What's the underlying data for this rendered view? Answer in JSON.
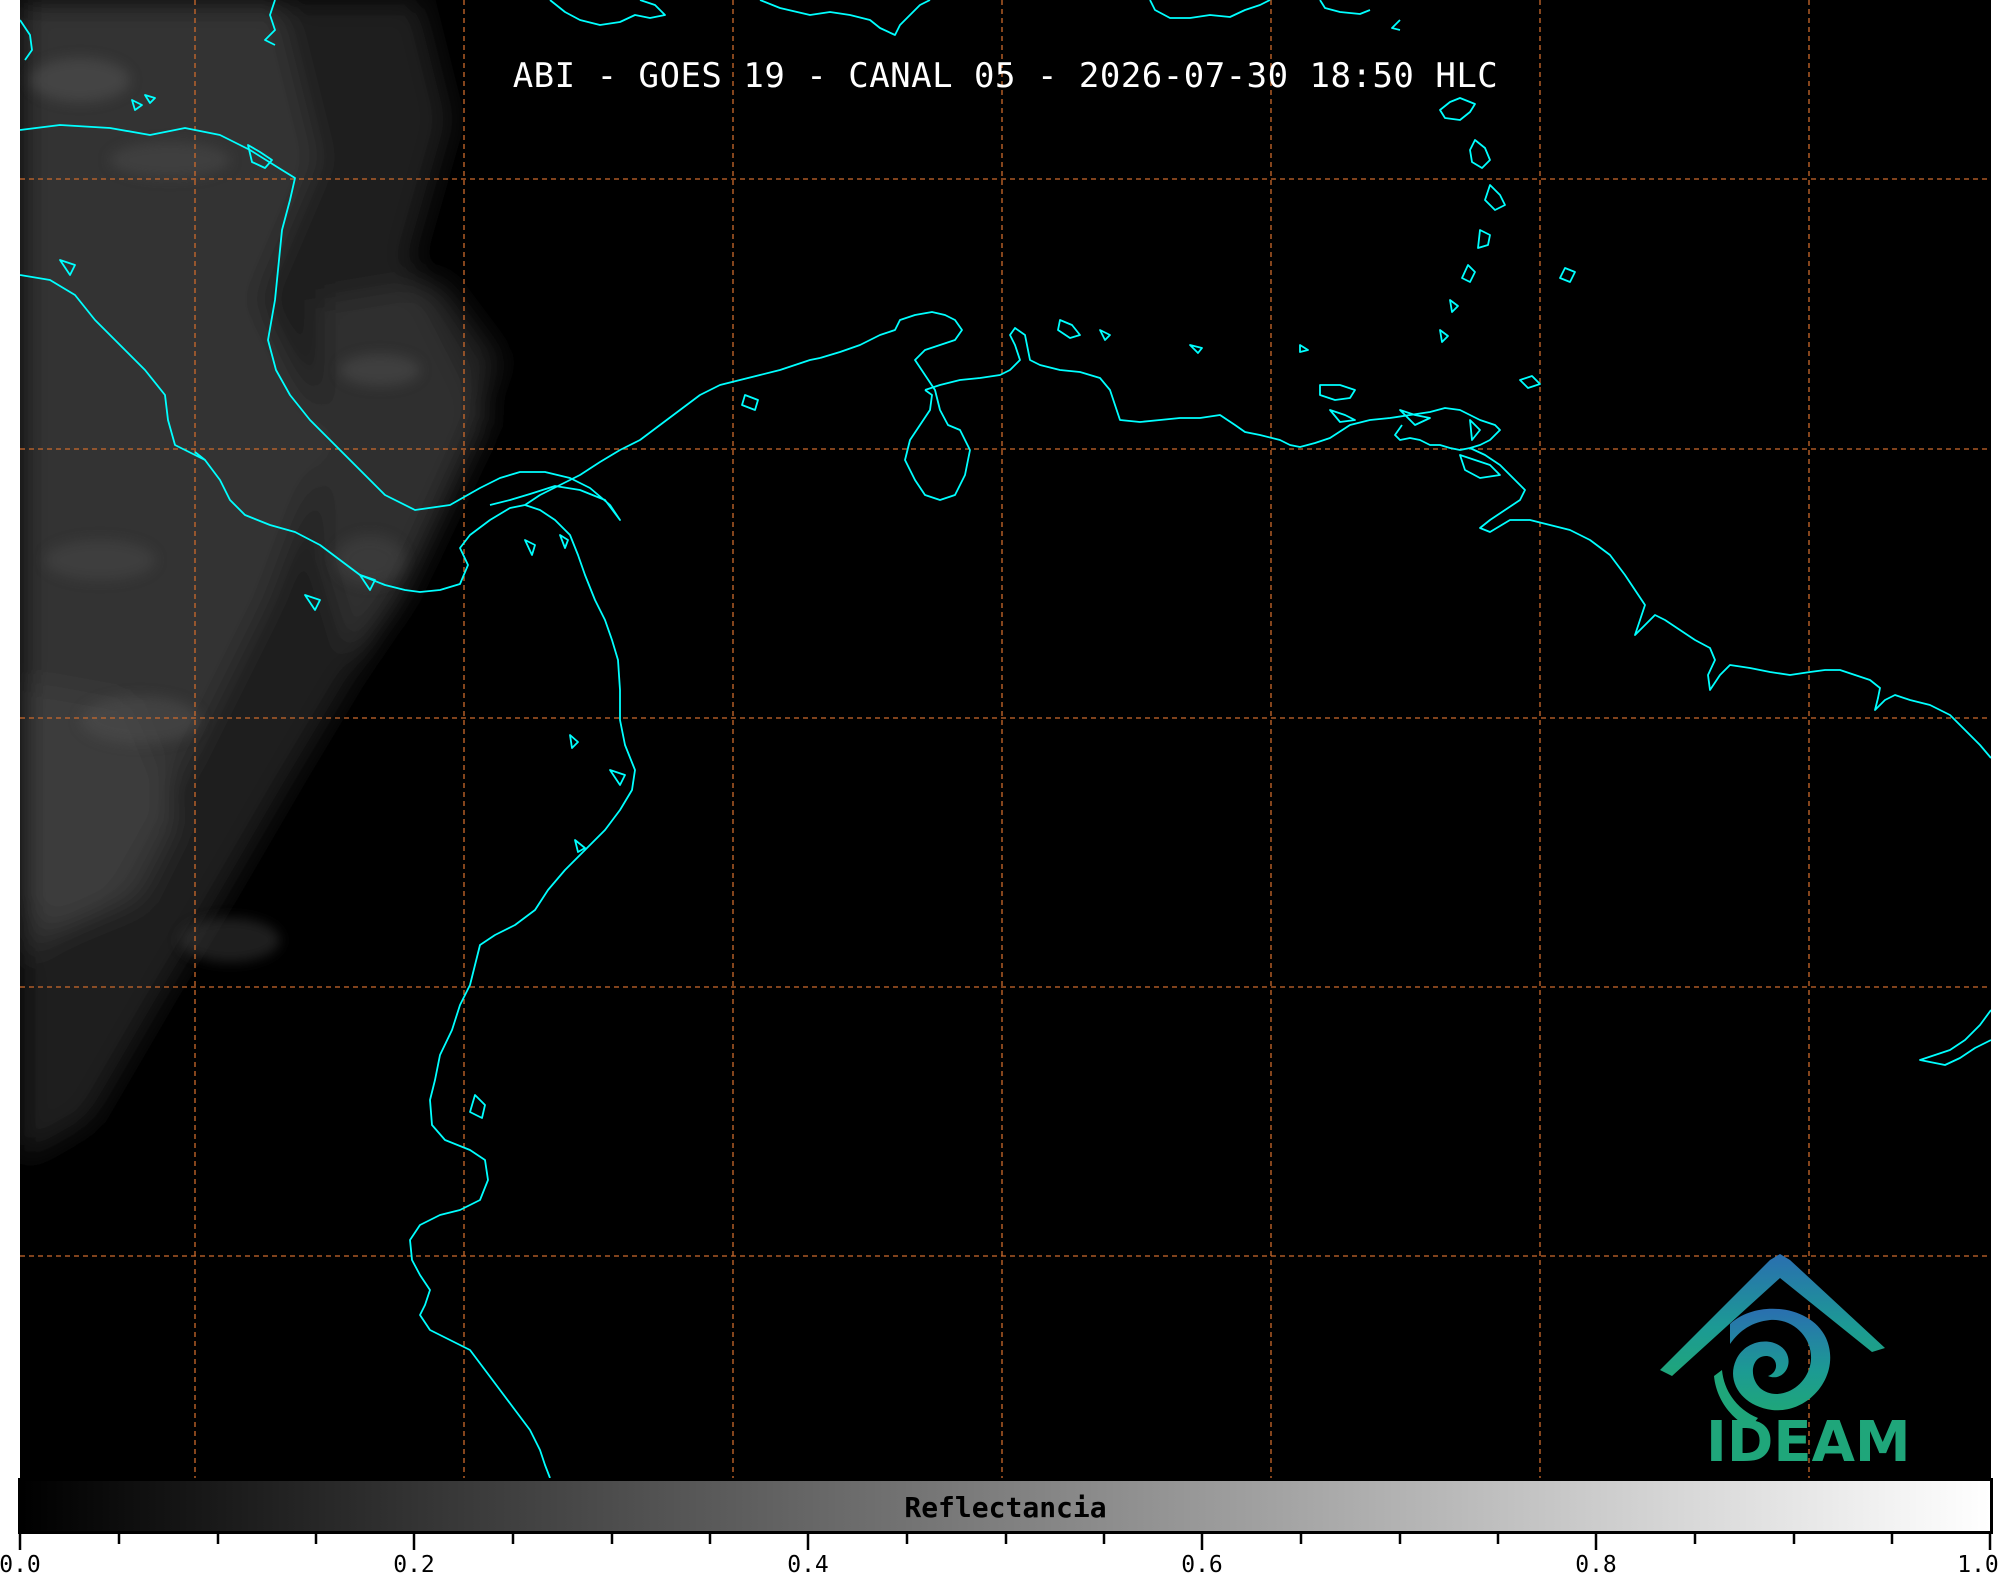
{
  "title": "ABI - GOES 19 - CANAL 05 - 2026-07-30 18:50 HLC",
  "colorbar": {
    "label": "Reflectancia",
    "tick_labels": [
      "0.0",
      "0.2",
      "0.4",
      "0.6",
      "0.8",
      "1.0"
    ],
    "range": [
      0.0,
      1.0
    ],
    "gradient": [
      "#000000",
      "#ffffff"
    ]
  },
  "logo": {
    "text": "IDEAM",
    "text_color": "#1fa67a",
    "icon": "ideam-logo-icon"
  },
  "colors": {
    "background": "#000000",
    "coastline": "#00ffff",
    "gridline": "#cc6a2c"
  }
}
